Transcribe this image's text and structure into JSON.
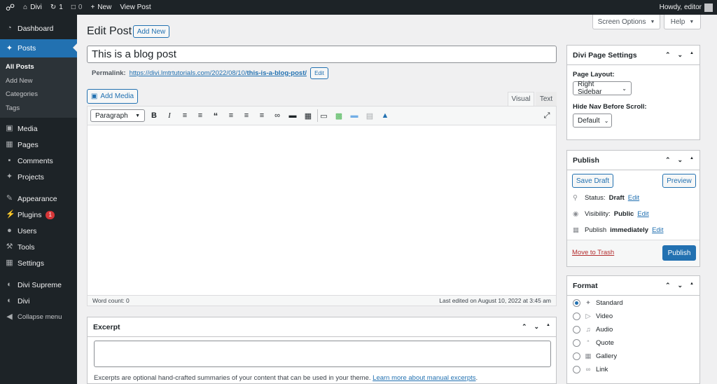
{
  "adminbar": {
    "site_name": "Divi",
    "updates_count": "1",
    "comments_count": "0",
    "new_label": "New",
    "view_post_label": "View Post",
    "howdy": "Howdy, editor"
  },
  "sidebar": {
    "items": [
      {
        "label": "Dashboard",
        "icon": "dashboard-icon"
      },
      {
        "label": "Posts",
        "icon": "pin-icon"
      },
      {
        "label": "Media",
        "icon": "media-icon"
      },
      {
        "label": "Pages",
        "icon": "pages-icon"
      },
      {
        "label": "Comments",
        "icon": "comment-icon"
      },
      {
        "label": "Projects",
        "icon": "pin-icon"
      },
      {
        "label": "Appearance",
        "icon": "brush-icon"
      },
      {
        "label": "Plugins",
        "icon": "plugin-icon",
        "badge": "1"
      },
      {
        "label": "Users",
        "icon": "user-icon"
      },
      {
        "label": "Tools",
        "icon": "wrench-icon"
      },
      {
        "label": "Settings",
        "icon": "settings-icon"
      },
      {
        "label": "Divi Supreme",
        "icon": "divi-icon"
      },
      {
        "label": "Divi",
        "icon": "divi-icon"
      },
      {
        "label": "Collapse menu",
        "icon": "collapse-icon"
      }
    ],
    "posts_submenu": [
      "All Posts",
      "Add New",
      "Categories",
      "Tags"
    ]
  },
  "header": {
    "title": "Edit Post",
    "add_new": "Add New",
    "screen_options": "Screen Options",
    "help": "Help"
  },
  "editor": {
    "post_title": "This is a blog post",
    "permalink_label": "Permalink:",
    "permalink_base": "https://divi.lmtrtutorials.com/2022/08/10/",
    "permalink_slug": "this-is-a-blog-post/",
    "permalink_edit": "Edit",
    "add_media": "Add Media",
    "tab_visual": "Visual",
    "tab_text": "Text",
    "format_select": "Paragraph",
    "word_count": "Word count: 0",
    "last_edited": "Last edited on August 10, 2022 at 3:45 am"
  },
  "excerpt": {
    "title": "Excerpt",
    "help_text": "Excerpts are optional hand-crafted summaries of your content that can be used in your theme.",
    "help_link": "Learn more about manual excerpts",
    "help_end": "."
  },
  "divi_settings": {
    "title": "Divi Page Settings",
    "page_layout_label": "Page Layout:",
    "page_layout_value": "Right Sidebar",
    "hide_nav_label": "Hide Nav Before Scroll:",
    "hide_nav_value": "Default"
  },
  "publish": {
    "title": "Publish",
    "save_draft": "Save Draft",
    "preview": "Preview",
    "status_label": "Status:",
    "status_value": "Draft",
    "visibility_label": "Visibility:",
    "visibility_value": "Public",
    "publish_label": "Publish",
    "publish_value": "immediately",
    "edit": "Edit",
    "trash": "Move to Trash",
    "publish_button": "Publish"
  },
  "format": {
    "title": "Format",
    "options": [
      "Standard",
      "Video",
      "Audio",
      "Quote",
      "Gallery",
      "Link"
    ],
    "selected": "Standard"
  },
  "colors": {
    "accent": "#2271b1",
    "adminbar": "#1d2327",
    "badge": "#d63638",
    "trash": "#b32d2e"
  }
}
